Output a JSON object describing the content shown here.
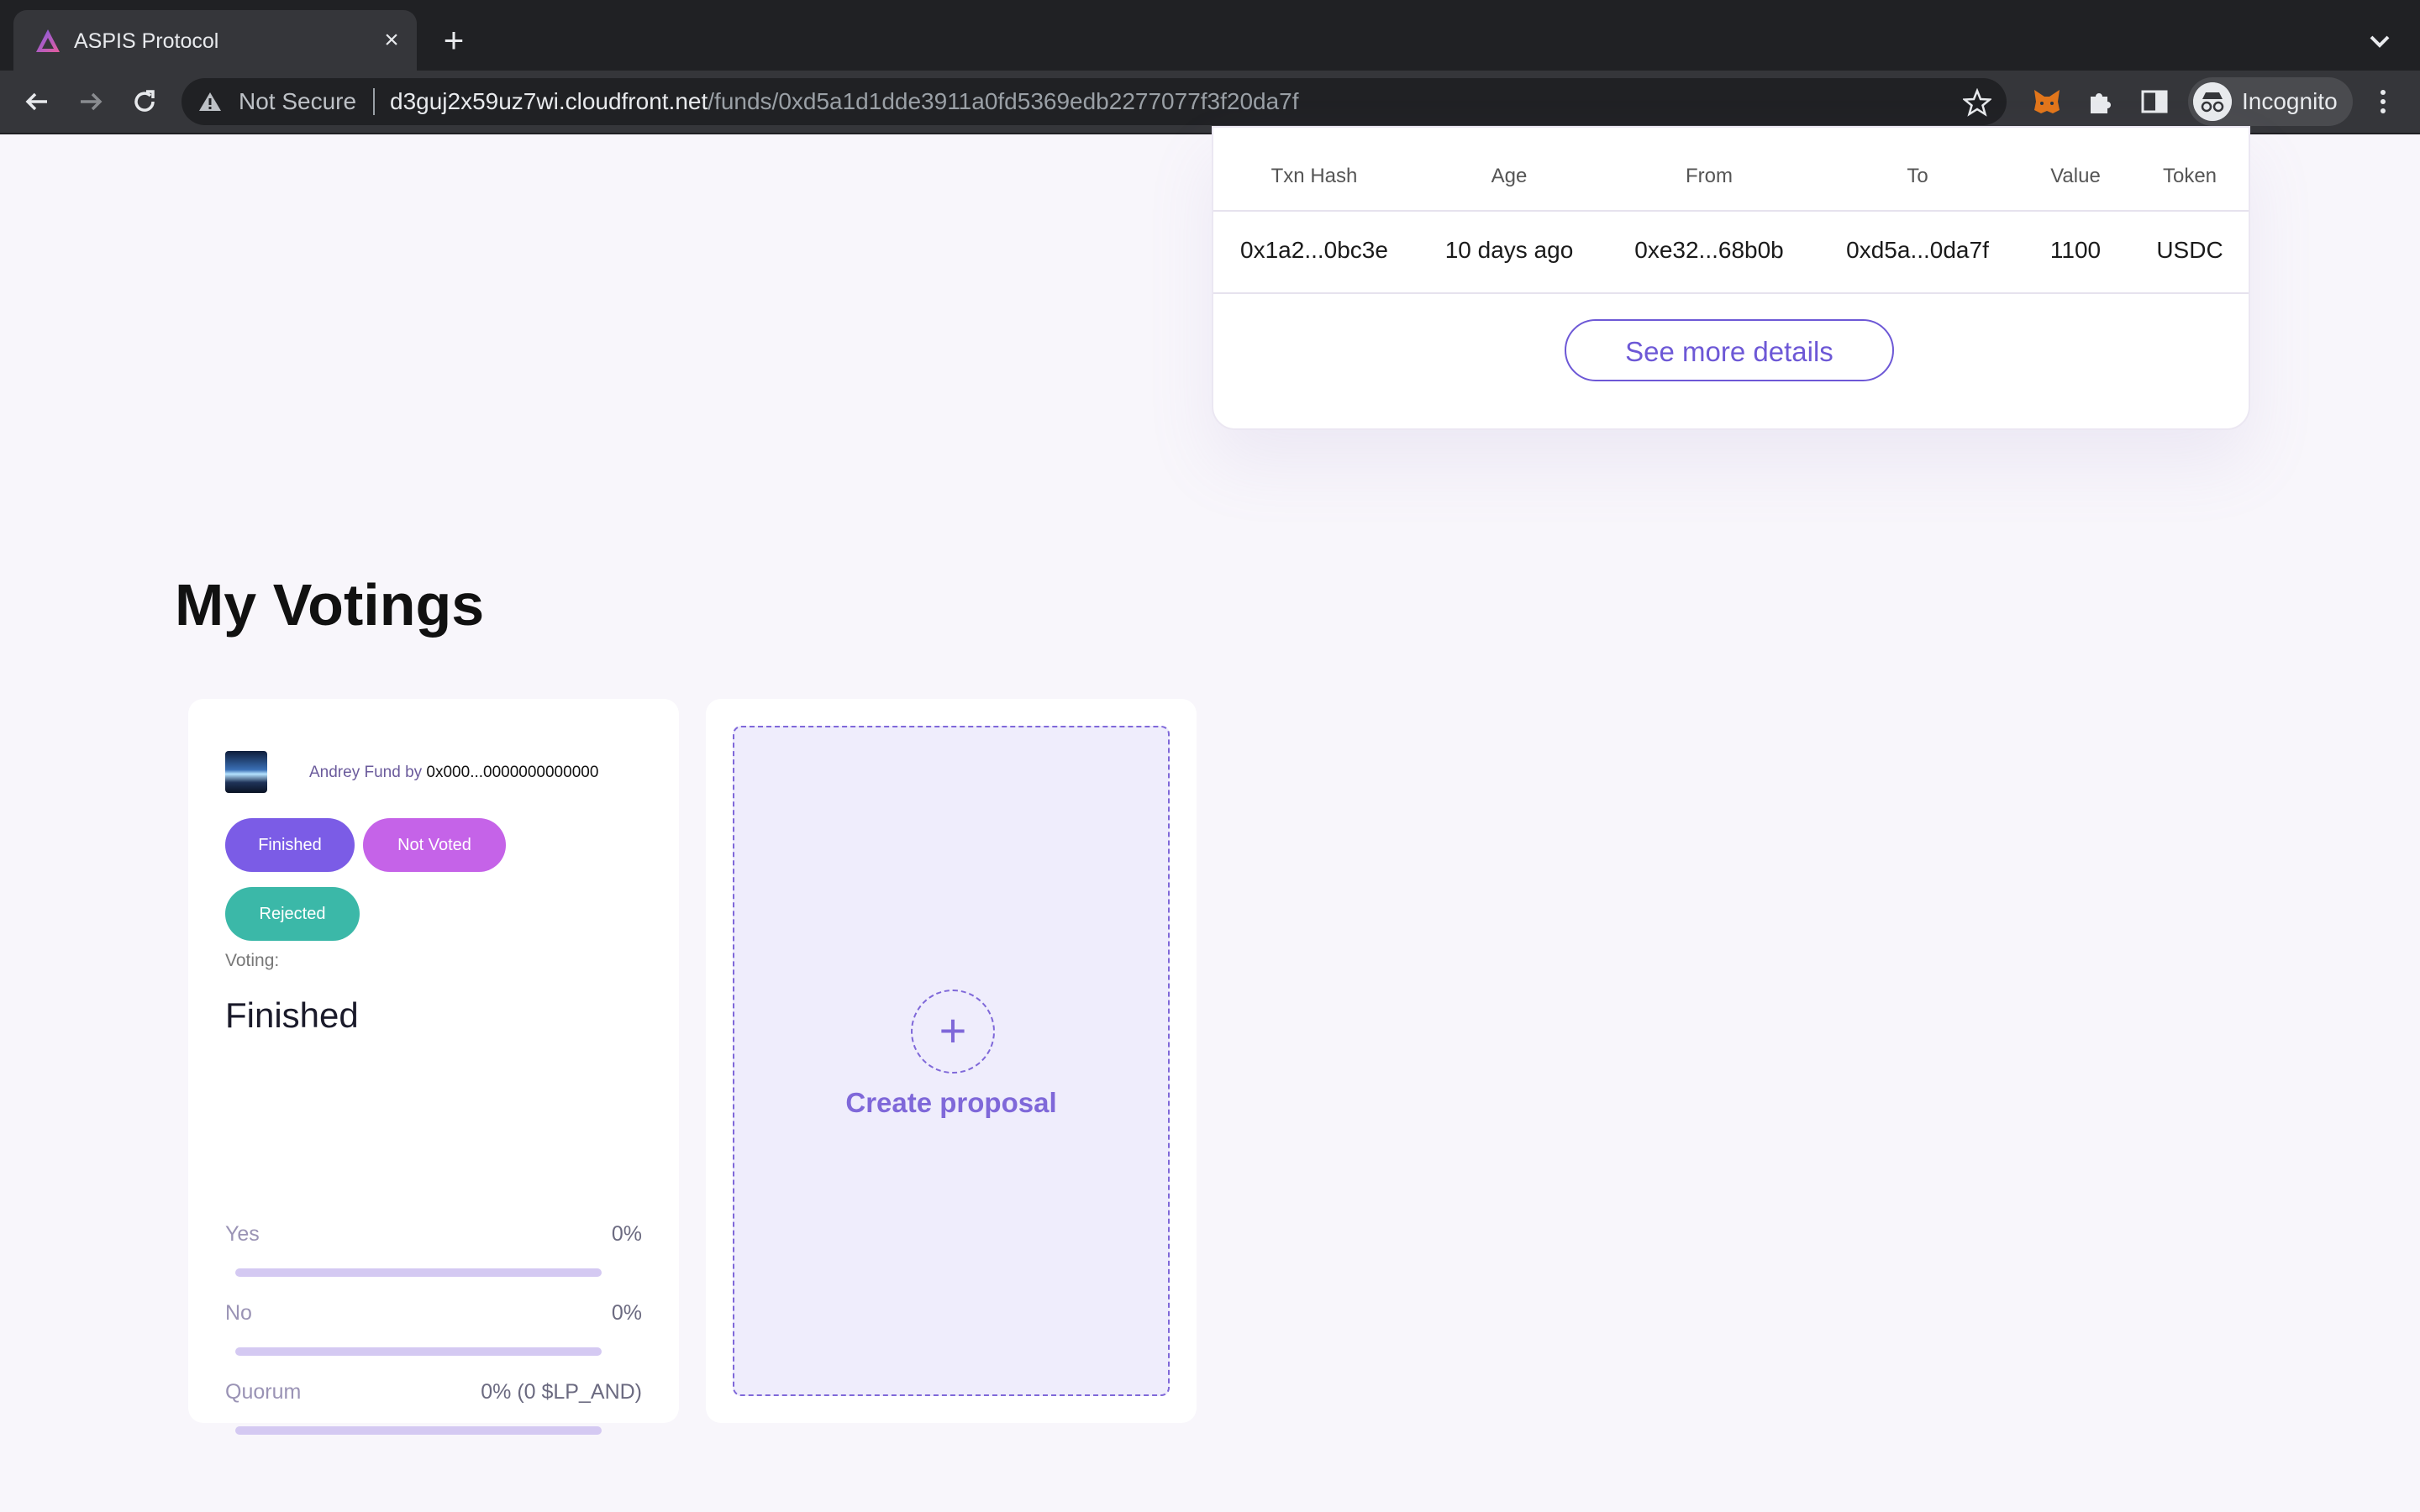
{
  "browser": {
    "tab_title": "ASPIS Protocol",
    "tab_close": "×",
    "new_tab": "+",
    "security_label": "Not Secure",
    "url_host": "d3guj2x59uz7wi.cloudfront.net",
    "url_path": "/funds/0xd5a1d1dde3911a0fd5369edb2277077f3f20da7f",
    "profile_label": "Incognito"
  },
  "transactions": {
    "headers": [
      "Txn Hash",
      "Age",
      "From",
      "To",
      "Value",
      "Token"
    ],
    "rows": [
      [
        "0x1a2...0bc3e",
        "10 days ago",
        "0xe32...68b0b",
        "0xd5a...0da7f",
        "1100",
        "USDC"
      ]
    ],
    "see_more_label": "See more details"
  },
  "votings": {
    "section_title": "My Votings",
    "cards": [
      {
        "fund_name": "Andrey Fund",
        "by_label": " by ",
        "creator": "0x000...0000000000000",
        "badges": [
          {
            "label": "Finished",
            "color": "#7b5ce6"
          },
          {
            "label": "Not Voted",
            "color": "#c563e8"
          },
          {
            "label": "Rejected",
            "color": "#3bb8a8"
          }
        ],
        "voting_label": "Voting:",
        "voting_status": "Finished",
        "metrics": [
          {
            "label": "Yes",
            "value": "0%",
            "fraction": 0
          },
          {
            "label": "No",
            "value": "0%",
            "fraction": 0
          },
          {
            "label": "Quorum",
            "value": "0% (0 $LP_AND)",
            "fraction": 0
          }
        ]
      }
    ],
    "create_label": "Create proposal",
    "create_icon": "+"
  },
  "colors": {
    "accent": "#6d58d6",
    "page_bg": "#f8f6fb"
  }
}
